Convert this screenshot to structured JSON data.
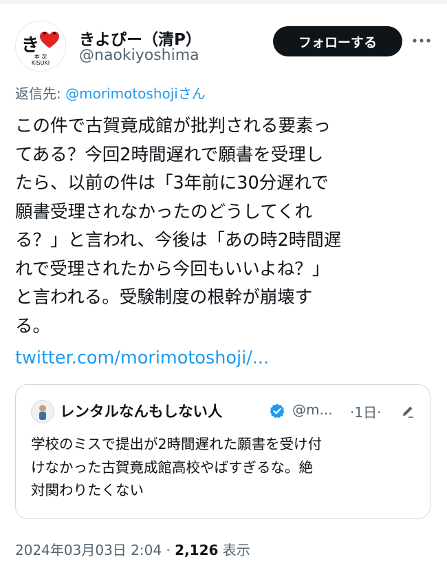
{
  "author": {
    "display_name": "きよぴー（清P）",
    "handle": "@naokiyoshima",
    "avatar_text_main": "き",
    "avatar_text_sub1": "本 次",
    "avatar_text_sub2": "KISUKI",
    "icon": "avatar-logo"
  },
  "follow_button": {
    "label": "フォローする"
  },
  "more_icon": "more-icon",
  "reply_to": {
    "prefix": "返信先:",
    "mention": "@morimotoshoji",
    "suffix": "さん"
  },
  "tweet": {
    "text": "この件で古賀竟成館が批判される要素っ\nてある？今回2時間遅れで願書を受理し\nたら、以前の件は「3年前に30分遅れで\n願書受理されなかったのどうしてくれ\nる？」と言われ、今後は「あの時2時間遅\nれで受理されたから今回もいいよね？」\nと言われる。受験制度の根幹が崩壊す\nる。",
    "link": "twitter.com/morimotoshoji/..."
  },
  "quoted_tweet": {
    "display_name": "レンタルなんもしない人",
    "handle": "@m...",
    "time": "·1日·",
    "verified_icon": "verified-badge-icon",
    "edit_icon": "edited-pencil-icon",
    "text": "学校のミスで提出が2時間遅れた願書を受け付\nけなかった古賀竟成館高校やばすぎるな。絶\n対関わりたくない"
  },
  "meta": {
    "datetime": "2024年03月03日 2:04",
    "separator": " · ",
    "views_count": "2,126",
    "views_label": " 表示"
  },
  "colors": {
    "text": "#0f1419",
    "secondary": "#536471",
    "link": "#1d9bf0",
    "follow_bg": "#0f1419",
    "heart": "#e0241f"
  }
}
